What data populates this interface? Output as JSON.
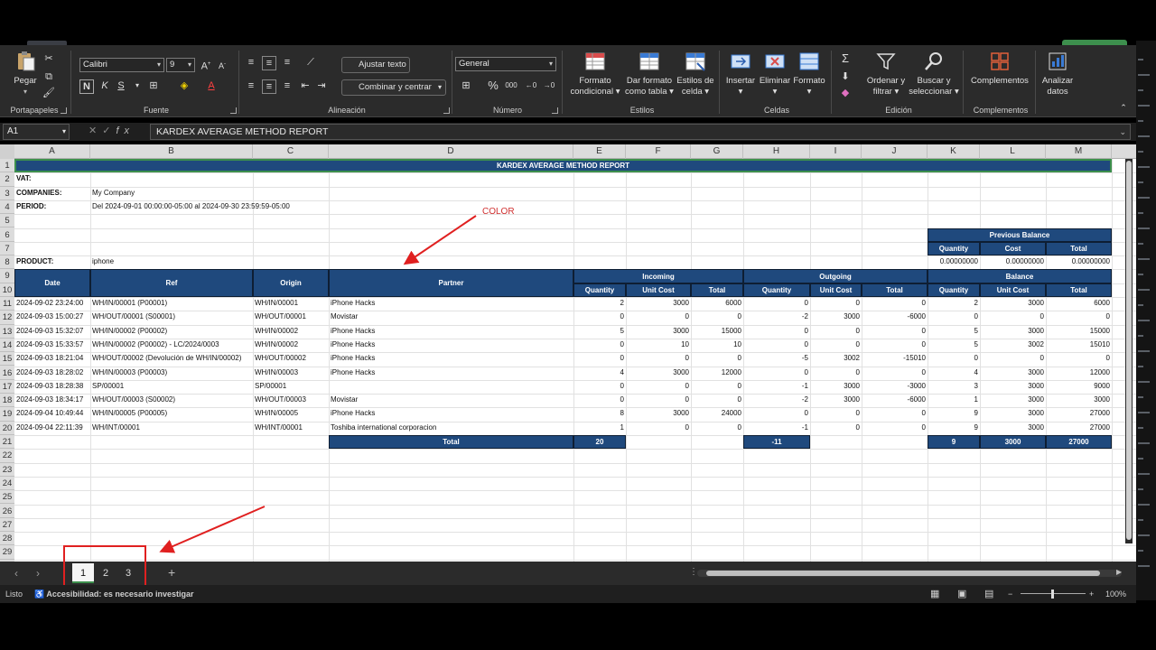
{
  "ribbon": {
    "portapapeles": {
      "paste": "Pegar",
      "label": "Portapapeles"
    },
    "fuente": {
      "font": "Calibri",
      "size": "9",
      "bold": "N",
      "italic": "K",
      "underline": "S",
      "label": "Fuente"
    },
    "alineacion": {
      "wrap": "Ajustar texto",
      "merge": "Combinar y centrar",
      "label": "Alineación"
    },
    "numero": {
      "format": "General",
      "percent": "%",
      "label": "Número"
    },
    "estilos": {
      "cond1": "Formato",
      "cond2": "condicional",
      "table1": "Dar formato",
      "table2": "como tabla",
      "cell1": "Estilos de",
      "cell2": "celda",
      "label": "Estilos"
    },
    "celdas": {
      "insert": "Insertar",
      "delete": "Eliminar",
      "format": "Formato",
      "label": "Celdas"
    },
    "edicion": {
      "sort1": "Ordenar y",
      "sort2": "filtrar",
      "find1": "Buscar y",
      "find2": "seleccionar",
      "label": "Edición"
    },
    "complementos": {
      "btn": "Complementos",
      "label": "Complementos"
    },
    "analizar": {
      "l1": "Analizar",
      "l2": "datos"
    }
  },
  "formula": {
    "namebox": "A1",
    "value": "KARDEX AVERAGE METHOD REPORT"
  },
  "columns": [
    "A",
    "B",
    "C",
    "D",
    "E",
    "F",
    "G",
    "H",
    "I",
    "J",
    "K",
    "L",
    "M"
  ],
  "rows": [
    "1",
    "2",
    "3",
    "4",
    "5",
    "6",
    "7",
    "8",
    "9",
    "10",
    "11",
    "12",
    "13",
    "14",
    "15",
    "16",
    "17",
    "18",
    "19",
    "20",
    "21",
    "22",
    "23",
    "24",
    "25",
    "26",
    "27",
    "28",
    "29"
  ],
  "report": {
    "title": "KARDEX AVERAGE METHOD REPORT",
    "vat": "VAT:",
    "companies_label": "COMPANIES:",
    "companies": "My Company",
    "period_label": "PERIOD:",
    "period": "Del 2024-09-01 00:00:00-05:00 al 2024-09-30 23:59:59-05:00",
    "product_label": "PRODUCT:",
    "product": "iphone",
    "prev_balance": "Previous Balance",
    "prev_qty": "Quantity",
    "prev_cost": "Cost",
    "prev_total": "Total",
    "prev_values": [
      "0.00000000",
      "0.00000000",
      "0.00000000"
    ],
    "h_date": "Date",
    "h_ref": "Ref",
    "h_origin": "Origin",
    "h_partner": "Partner",
    "h_incoming": "Incoming",
    "h_outgoing": "Outgoing",
    "h_balance": "Balance",
    "sub_qty": "Quantity",
    "sub_unit": "Unit Cost",
    "sub_total": "Total",
    "total_label": "Total",
    "totals": {
      "in_qty": "20",
      "out_qty": "-11",
      "bal_qty": "9",
      "bal_unit": "3000",
      "bal_total": "27000"
    },
    "data": [
      [
        "2024-09-02 23:24:00",
        "WH/IN/00001 (P00001)",
        "WH/IN/00001",
        "iPhone Hacks",
        "2",
        "3000",
        "6000",
        "0",
        "0",
        "0",
        "2",
        "3000",
        "6000"
      ],
      [
        "2024-09-03 15:00:27",
        "WH/OUT/00001 (S00001)",
        "WH/OUT/00001",
        "Movistar",
        "0",
        "0",
        "0",
        "-2",
        "3000",
        "-6000",
        "0",
        "0",
        "0"
      ],
      [
        "2024-09-03 15:32:07",
        "WH/IN/00002 (P00002)",
        "WH/IN/00002",
        "iPhone Hacks",
        "5",
        "3000",
        "15000",
        "0",
        "0",
        "0",
        "5",
        "3000",
        "15000"
      ],
      [
        "2024-09-03 15:33:57",
        "WH/IN/00002 (P00002) - LC/2024/0003",
        "WH/IN/00002",
        "iPhone Hacks",
        "0",
        "10",
        "10",
        "0",
        "0",
        "0",
        "5",
        "3002",
        "15010"
      ],
      [
        "2024-09-03 18:21:04",
        "WH/OUT/00002 (Devolución de WH/IN/00002)",
        "WH/OUT/00002",
        "iPhone Hacks",
        "0",
        "0",
        "0",
        "-5",
        "3002",
        "-15010",
        "0",
        "0",
        "0"
      ],
      [
        "2024-09-03 18:28:02",
        "WH/IN/00003 (P00003)",
        "WH/IN/00003",
        "iPhone Hacks",
        "4",
        "3000",
        "12000",
        "0",
        "0",
        "0",
        "4",
        "3000",
        "12000"
      ],
      [
        "2024-09-03 18:28:38",
        "SP/00001",
        "SP/00001",
        "",
        "0",
        "0",
        "0",
        "-1",
        "3000",
        "-3000",
        "3",
        "3000",
        "9000"
      ],
      [
        "2024-09-03 18:34:17",
        "WH/OUT/00003 (S00002)",
        "WH/OUT/00003",
        "Movistar",
        "0",
        "0",
        "0",
        "-2",
        "3000",
        "-6000",
        "1",
        "3000",
        "3000"
      ],
      [
        "2024-09-04 10:49:44",
        "WH/IN/00005 (P00005)",
        "WH/IN/00005",
        "iPhone Hacks",
        "8",
        "3000",
        "24000",
        "0",
        "0",
        "0",
        "9",
        "3000",
        "27000"
      ],
      [
        "2024-09-04 22:11:39",
        "WH/INT/00001",
        "WH/INT/00001",
        "Toshiba international corporacion",
        "1",
        "0",
        "0",
        "-1",
        "0",
        "0",
        "9",
        "3000",
        "27000"
      ]
    ]
  },
  "annotation": {
    "color_note": "COLOR"
  },
  "tabs": [
    "1",
    "2",
    "3"
  ],
  "status": {
    "ready": "Listo",
    "accessibility": "Accesibilidad: es necesario investigar",
    "zoom": "100%"
  }
}
